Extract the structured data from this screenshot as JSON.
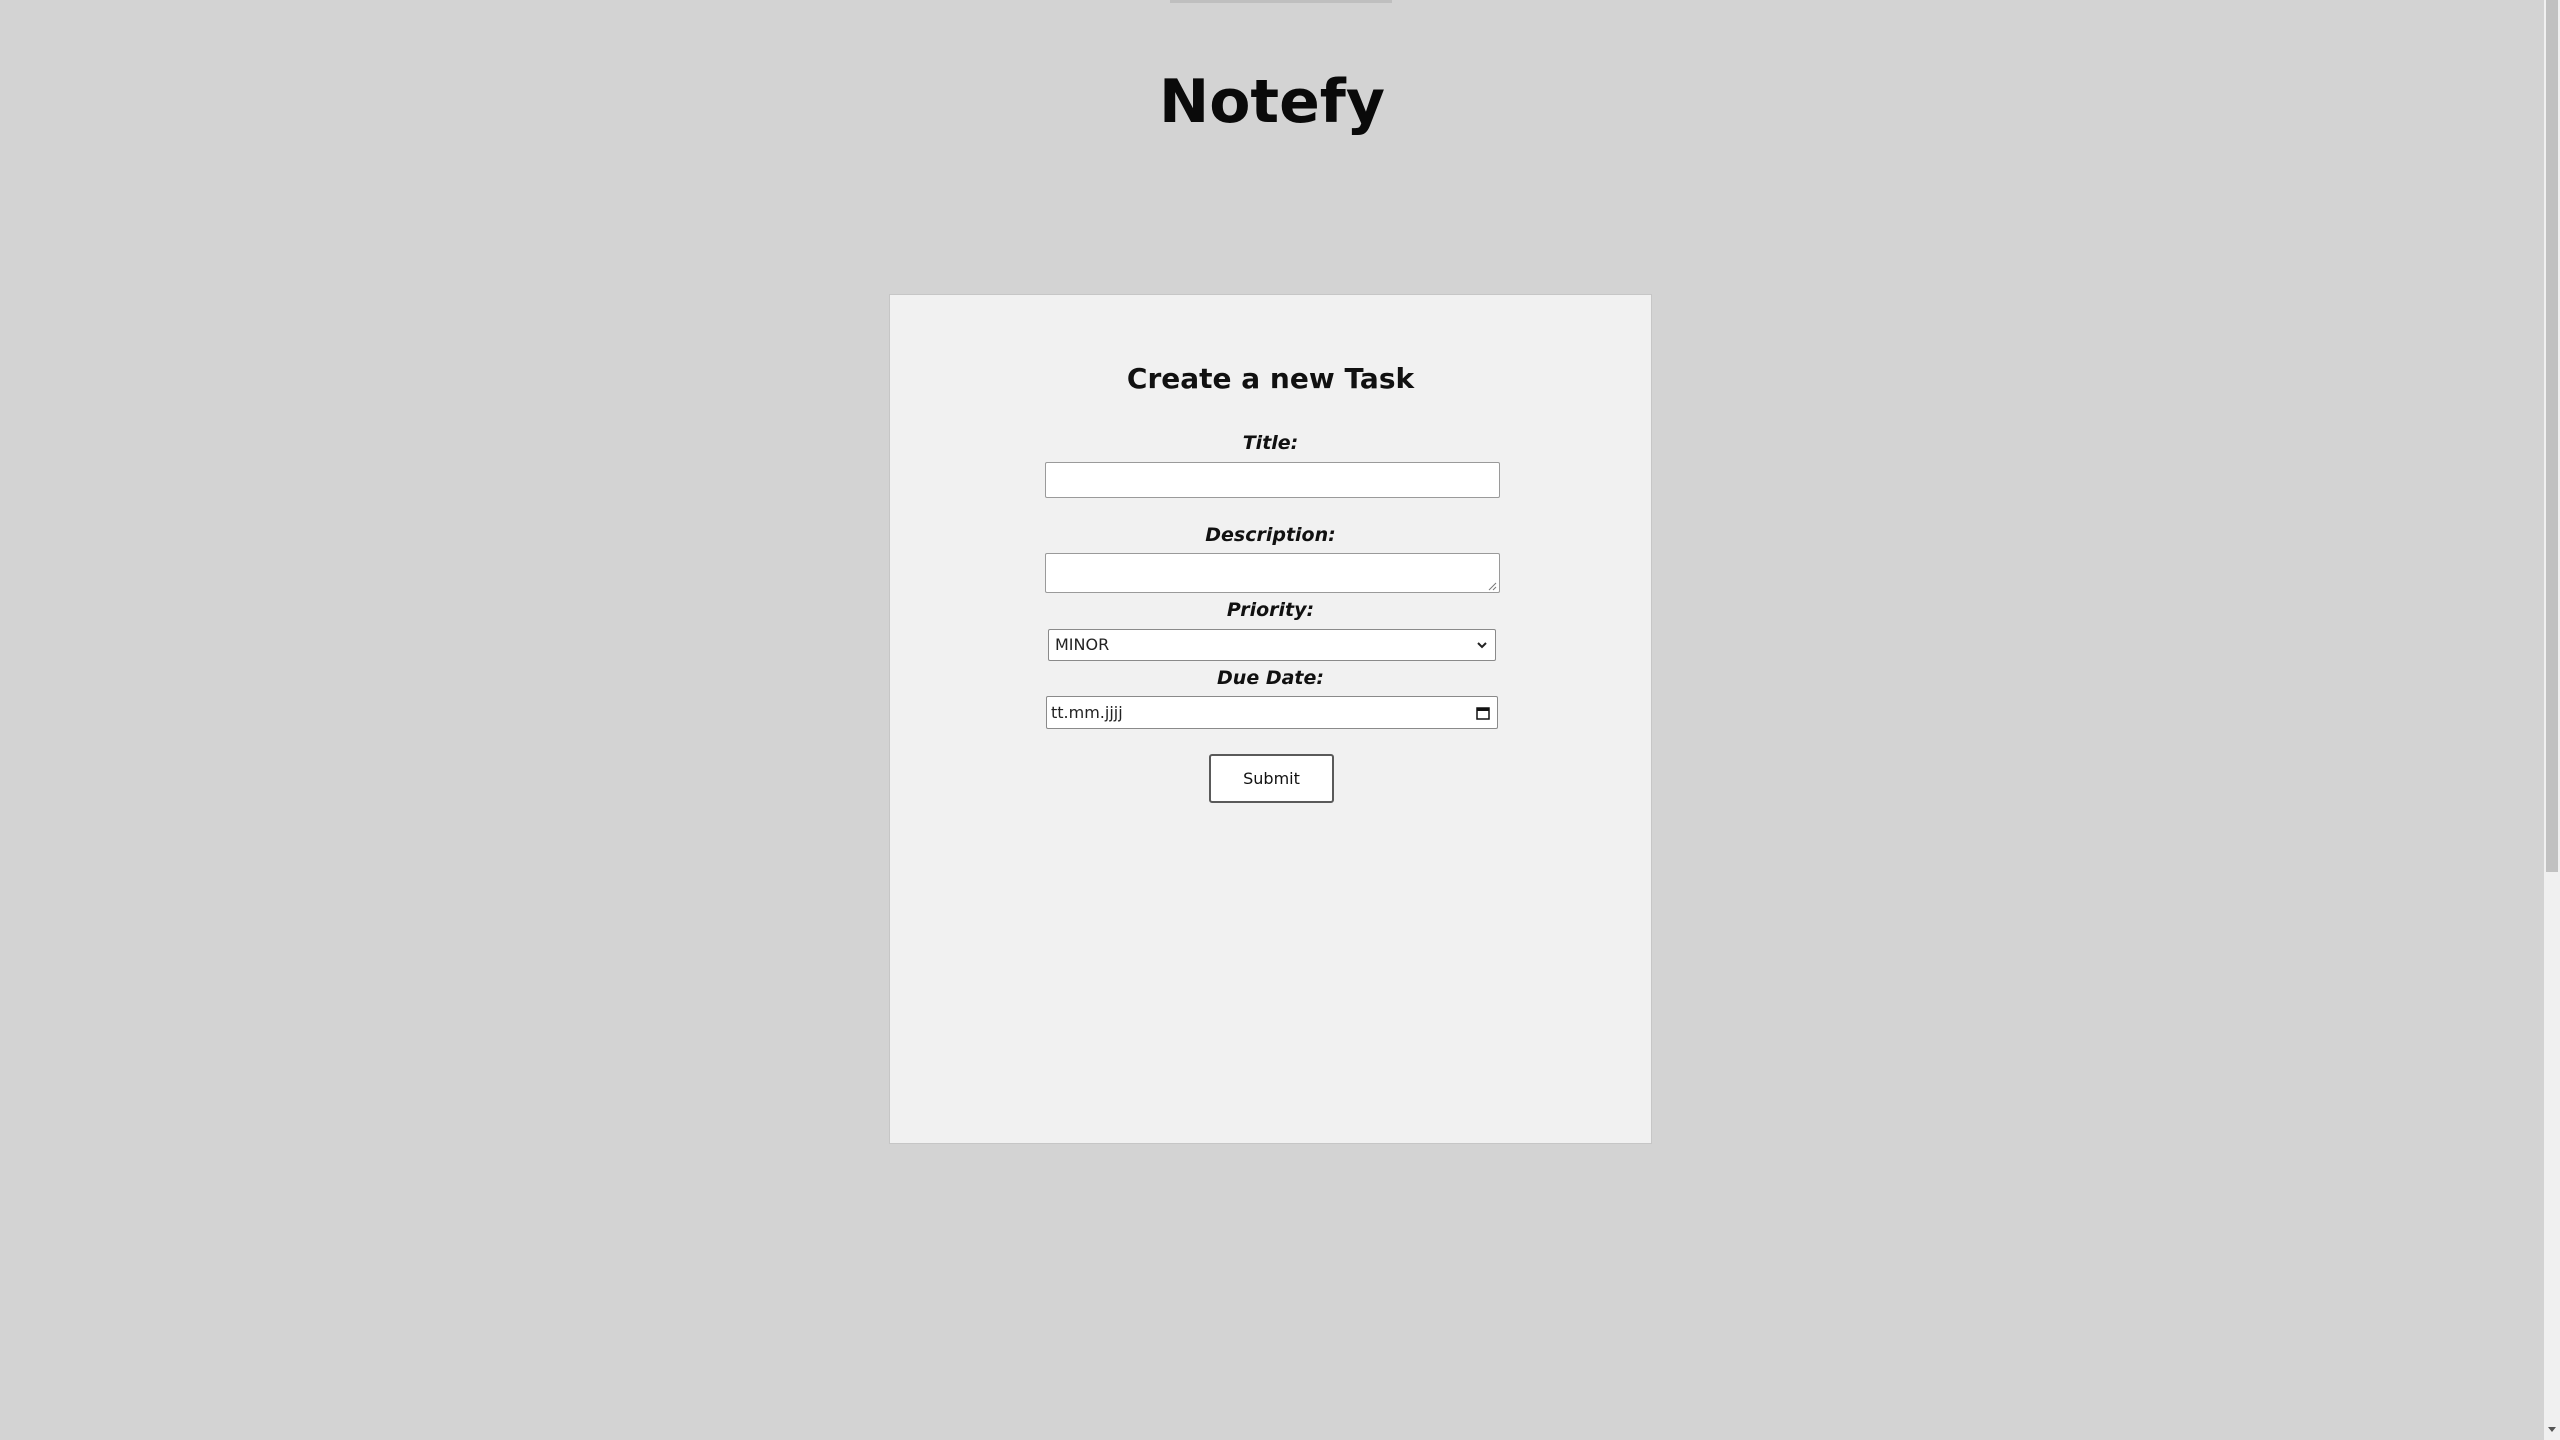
{
  "app": {
    "title": "Notefy"
  },
  "form": {
    "heading": "Create a new Task",
    "title_label": "Title:",
    "title_value": "",
    "description_label": "Description:",
    "description_value": "",
    "priority_label": "Priority:",
    "priority_selected": "MINOR",
    "due_date_label": "Due Date:",
    "due_date_placeholder": "tt.mm.jjjj",
    "submit_label": "Submit"
  },
  "icons": {
    "select_arrow": "chevron-down-icon",
    "calendar": "calendar-icon",
    "resize": "resize-grip-icon",
    "scroll_down": "scroll-down-arrow-icon"
  },
  "colors": {
    "page_background": "#d3d3d3",
    "card_background": "#f1f1f1",
    "text": "#111111"
  }
}
